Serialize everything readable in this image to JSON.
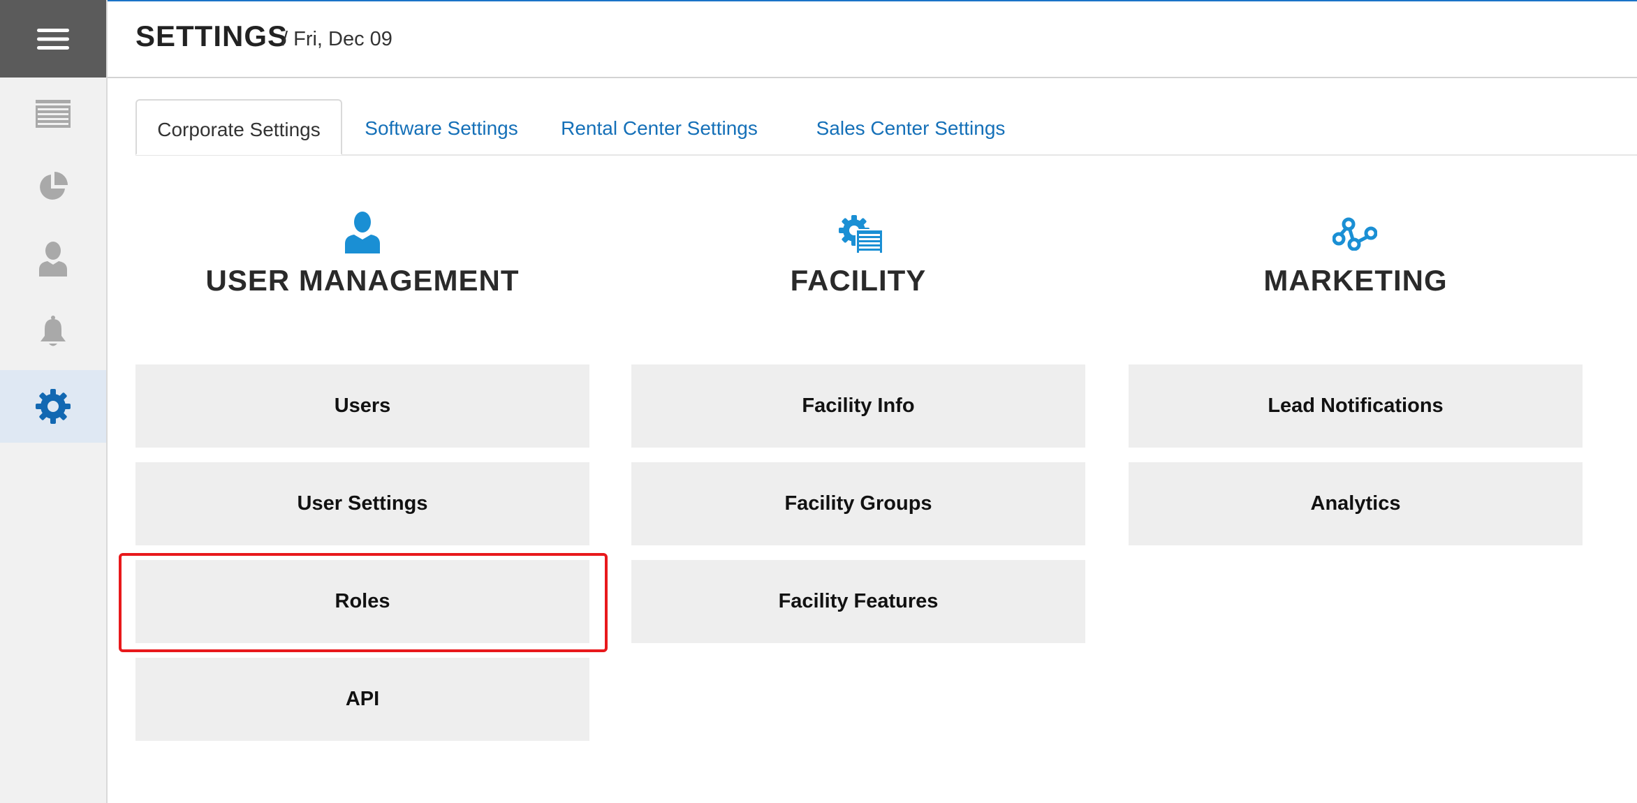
{
  "header": {
    "title": "SETTINGS",
    "date": "/ Fri, Dec 09"
  },
  "sidebar": {
    "menu_icon": "hamburger-icon",
    "items": [
      {
        "icon": "storage-unit-icon",
        "active": false
      },
      {
        "icon": "pie-chart-icon",
        "active": false
      },
      {
        "icon": "user-icon",
        "active": false
      },
      {
        "icon": "bell-icon",
        "active": false
      },
      {
        "icon": "gear-icon",
        "active": true
      }
    ]
  },
  "tabs": [
    {
      "label": "Corporate Settings",
      "active": true
    },
    {
      "label": "Software Settings",
      "active": false
    },
    {
      "label": "Rental Center Settings",
      "active": false
    },
    {
      "label": "Sales Center Settings",
      "active": false
    }
  ],
  "sections": [
    {
      "title": "USER MANAGEMENT",
      "icon": "user-icon",
      "items": [
        "Users",
        "User Settings",
        "Roles",
        "API"
      ]
    },
    {
      "title": "FACILITY",
      "icon": "facility-gear-icon",
      "items": [
        "Facility Info",
        "Facility Groups",
        "Facility Features"
      ]
    },
    {
      "title": "MARKETING",
      "icon": "network-nodes-icon",
      "items": [
        "Lead Notifications",
        "Analytics"
      ]
    }
  ],
  "colors": {
    "accent": "#1570b8",
    "icon_blue": "#1a8fd4",
    "tile_bg": "#eeeeee",
    "highlight": "#e8191c",
    "sidebar_icon": "#a9a9a9",
    "active_icon": "#1268b2"
  }
}
